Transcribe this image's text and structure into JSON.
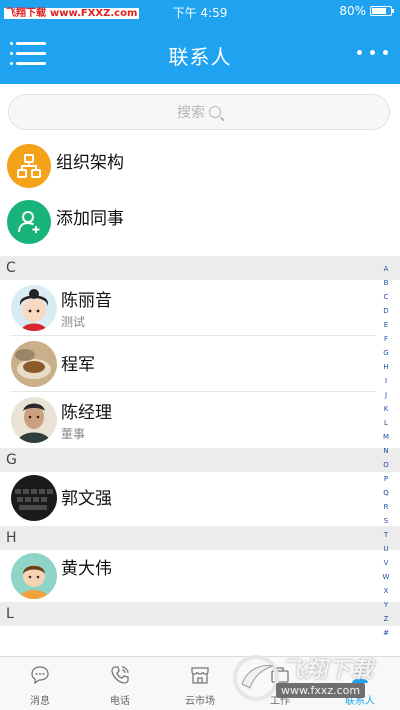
{
  "status_bar": {
    "site_brand": "飞翔下载",
    "site_url": "www.FXXZ.com",
    "time": "下午 4:59",
    "battery": "80%",
    "battery_level": 0.8
  },
  "nav": {
    "title": "联系人",
    "menu_icon": "list-menu-icon",
    "more_icon": "more-dots-icon"
  },
  "search": {
    "placeholder": "搜索"
  },
  "quick_entries": [
    {
      "label": "组织架构",
      "icon": "org-chart-icon",
      "color": "#f4a217"
    },
    {
      "label": "添加同事",
      "icon": "add-user-icon",
      "color": "#18b37a"
    }
  ],
  "sections": [
    {
      "letter": "C",
      "contacts": [
        {
          "name": "陈丽音",
          "sub": "测试"
        },
        {
          "name": "程军",
          "sub": ""
        },
        {
          "name": "陈经理",
          "sub": "董事"
        }
      ]
    },
    {
      "letter": "G",
      "contacts": [
        {
          "name": "郭文强",
          "sub": ""
        }
      ]
    },
    {
      "letter": "H",
      "contacts": [
        {
          "name": "黄大伟",
          "sub": ""
        }
      ]
    },
    {
      "letter": "L",
      "contacts": []
    }
  ],
  "index_letters": [
    "A",
    "B",
    "C",
    "D",
    "E",
    "F",
    "G",
    "H",
    "I",
    "J",
    "K",
    "L",
    "M",
    "N",
    "O",
    "P",
    "Q",
    "R",
    "S",
    "T",
    "U",
    "V",
    "W",
    "X",
    "Y",
    "Z",
    "#"
  ],
  "tabs": [
    {
      "label": "消息",
      "icon": "chat-bubble-icon",
      "active": false
    },
    {
      "label": "电话",
      "icon": "phone-icon",
      "active": false
    },
    {
      "label": "云市场",
      "icon": "store-icon",
      "active": false
    },
    {
      "label": "工作",
      "icon": "work-icon",
      "active": false
    },
    {
      "label": "联系人",
      "icon": "contacts-icon",
      "active": true
    }
  ],
  "watermark": {
    "text": "飞翔下载",
    "url": "www.fxxz.com"
  },
  "colors": {
    "accent": "#1fa3f0",
    "orange": "#f4a217",
    "green": "#18b37a",
    "index_text": "#1f4fa0"
  }
}
